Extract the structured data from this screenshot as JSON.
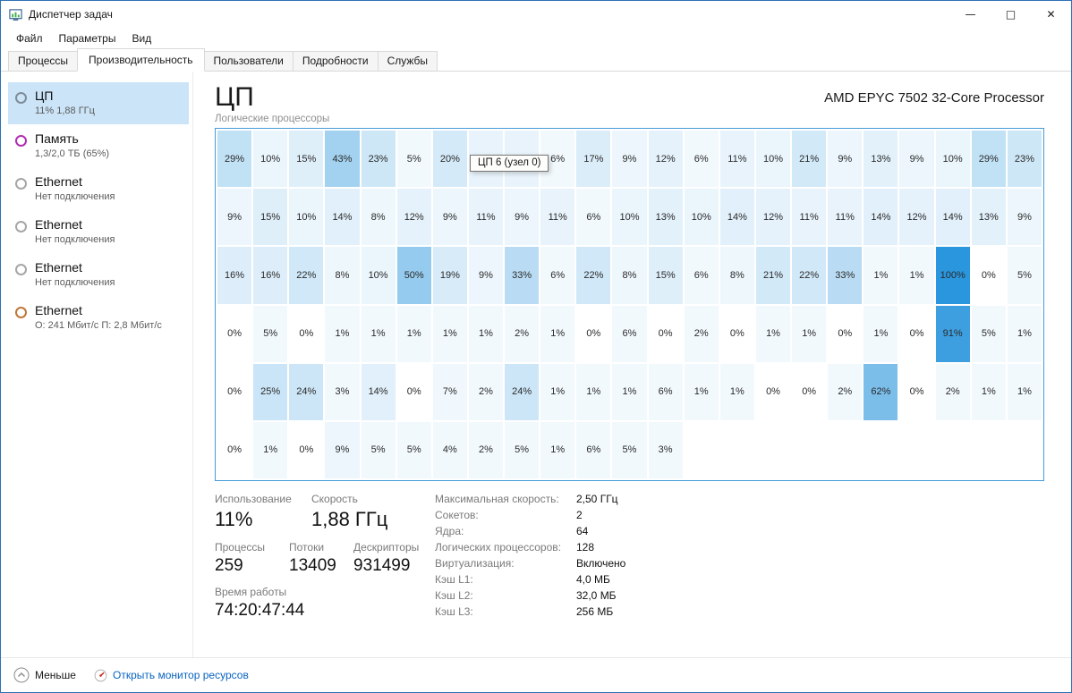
{
  "window": {
    "title": "Диспетчер задач",
    "controls": {
      "minimize": "—",
      "maximize": "□",
      "close": "✕"
    }
  },
  "menu": {
    "items": [
      {
        "key": "file",
        "label": "Файл"
      },
      {
        "key": "options",
        "label": "Параметры"
      },
      {
        "key": "view",
        "label": "Вид"
      }
    ]
  },
  "tabs": [
    {
      "key": "processes",
      "label": "Процессы",
      "active": false
    },
    {
      "key": "performance",
      "label": "Производительность",
      "active": true
    },
    {
      "key": "users",
      "label": "Пользователи",
      "active": false
    },
    {
      "key": "details",
      "label": "Подробности",
      "active": false
    },
    {
      "key": "services",
      "label": "Службы",
      "active": false
    }
  ],
  "sidebar": {
    "items": [
      {
        "key": "cpu",
        "title": "ЦП",
        "subtitle": "11% 1,88 ГГц",
        "color": "#7f8c99",
        "selected": true
      },
      {
        "key": "memory",
        "title": "Память",
        "subtitle": "1,3/2,0 ТБ (65%)",
        "color": "#b12fb1",
        "selected": false
      },
      {
        "key": "ethernet-1",
        "title": "Ethernet",
        "subtitle": "Нет подключения",
        "color": "#a6a6a6",
        "selected": false
      },
      {
        "key": "ethernet-2",
        "title": "Ethernet",
        "subtitle": "Нет подключения",
        "color": "#a6a6a6",
        "selected": false
      },
      {
        "key": "ethernet-3",
        "title": "Ethernet",
        "subtitle": "Нет подключения",
        "color": "#a6a6a6",
        "selected": false
      },
      {
        "key": "ethernet-4",
        "title": "Ethernet",
        "subtitle": "О: 241 Мбит/с П: 2,8 Мбит/с",
        "color": "#bf7636",
        "selected": false
      }
    ]
  },
  "main": {
    "title": "ЦП",
    "cpu_name": "AMD EPYC 7502 32-Core Processor",
    "grid_label": "Логические процессоры",
    "tooltip": "ЦП 6 (узел 0)",
    "stats_left": {
      "usage_label": "Использование",
      "usage_value": "11%",
      "speed_label": "Скорость",
      "speed_value": "1,88 ГГц",
      "processes_label": "Процессы",
      "processes_value": "259",
      "threads_label": "Потоки",
      "threads_value": "13409",
      "handles_label": "Дескрипторы",
      "handles_value": "931499",
      "uptime_label": "Время работы",
      "uptime_value": "74:20:47:44"
    },
    "stats_right": [
      {
        "label": "Максимальная скорость:",
        "value": "2,50 ГГц"
      },
      {
        "label": "Сокетов:",
        "value": "2"
      },
      {
        "label": "Ядра:",
        "value": "64"
      },
      {
        "label": "Логических процессоров:",
        "value": "128"
      },
      {
        "label": "Виртуализация:",
        "value": "Включено"
      },
      {
        "label": "Кэш L1:",
        "value": "4,0 МБ"
      },
      {
        "label": "Кэш L2:",
        "value": "32,0 МБ"
      },
      {
        "label": "Кэш L3:",
        "value": "256 МБ"
      }
    ]
  },
  "chart_data": {
    "type": "heatmap",
    "title": "Логические процессоры",
    "unit": "%",
    "cell_suffix": "%",
    "columns": 23,
    "rows": 6,
    "max_color": "#2a96dd",
    "values": [
      [
        29,
        10,
        15,
        43,
        23,
        5,
        20,
        11,
        11,
        6,
        17,
        9,
        12,
        6,
        11,
        10,
        21,
        9,
        13,
        9,
        10,
        29,
        23
      ],
      [
        9,
        15,
        10,
        14,
        8,
        12,
        9,
        11,
        9,
        11,
        6,
        10,
        13,
        10,
        14,
        12,
        11,
        11,
        14,
        12,
        14,
        13,
        9
      ],
      [
        16,
        16,
        22,
        8,
        10,
        50,
        19,
        9,
        33,
        6,
        22,
        8,
        15,
        6,
        8,
        21,
        22,
        33,
        1,
        1,
        100,
        0,
        5
      ],
      [
        0,
        5,
        0,
        1,
        1,
        1,
        1,
        1,
        2,
        1,
        0,
        6,
        0,
        2,
        0,
        1,
        1,
        0,
        1,
        0,
        91,
        5,
        1
      ],
      [
        0,
        25,
        24,
        3,
        14,
        0,
        7,
        2,
        24,
        1,
        1,
        1,
        6,
        1,
        1,
        0,
        0,
        2,
        62,
        0,
        2,
        1,
        1
      ],
      [
        0,
        1,
        0,
        9,
        5,
        5,
        4,
        2,
        5,
        1,
        6,
        5,
        3
      ]
    ]
  },
  "footer": {
    "less_label": "Меньше",
    "resmon_label": "Открыть монитор ресурсов",
    "link_color": "#0a64c0"
  }
}
